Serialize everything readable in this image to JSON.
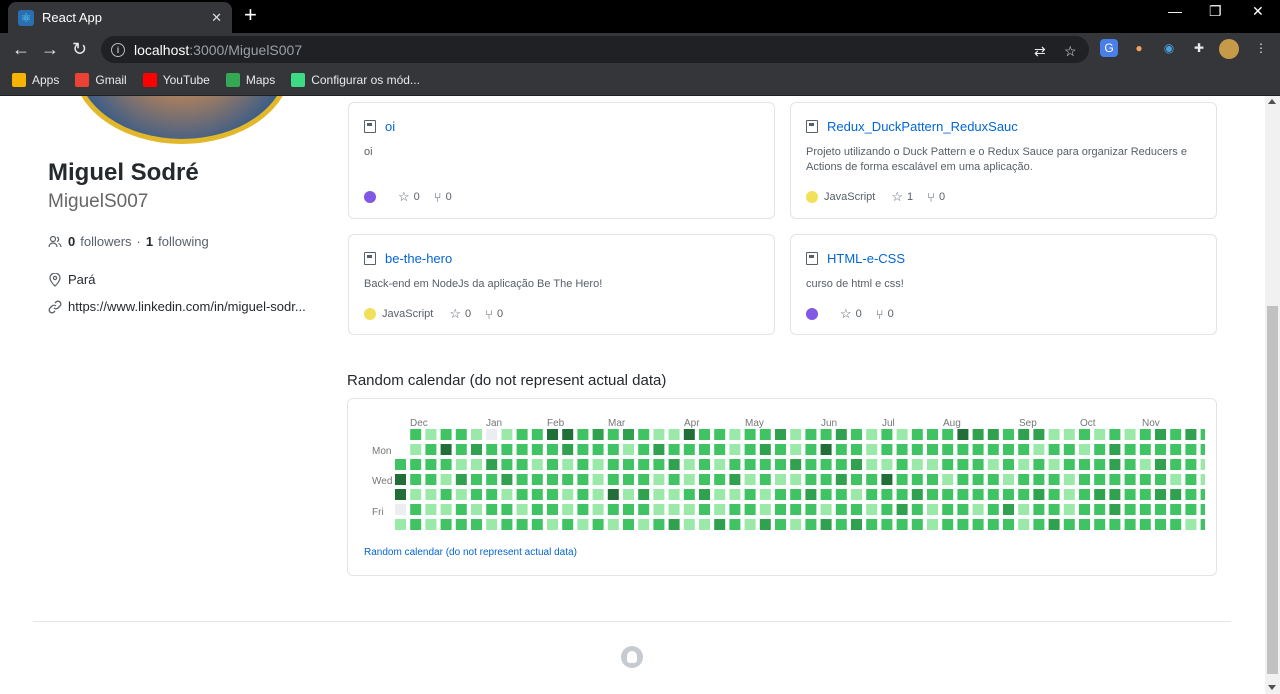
{
  "browser": {
    "tab_title": "React App",
    "tab_close": "✕",
    "new_tab": "+",
    "url_host": "localhost",
    "url_rest": ":3000/MiguelS007",
    "bookmarks": [
      {
        "label": "Apps",
        "icon": "apps-grid-icon",
        "color": "#f4b400"
      },
      {
        "label": "Gmail",
        "icon": "gmail-icon",
        "color": "#ea4335"
      },
      {
        "label": "YouTube",
        "icon": "youtube-icon",
        "color": "#ff0000"
      },
      {
        "label": "Maps",
        "icon": "maps-icon",
        "color": "#34a853"
      },
      {
        "label": "Configurar os mód...",
        "icon": "router-config-icon",
        "color": "#3ddc84"
      }
    ]
  },
  "profile": {
    "name": "Miguel Sodré",
    "login": "MiguelS007",
    "followers_count": "0",
    "followers_label": "followers",
    "separator": "·",
    "following_count": "1",
    "following_label": "following",
    "location": "Pará",
    "website": "https://www.linkedin.com/in/miguel-sodr..."
  },
  "repos": [
    {
      "name": "oi",
      "description": "oi",
      "language": "",
      "language_color": "#8257e5",
      "stars": "0",
      "forks": "0"
    },
    {
      "name": "Redux_DuckPattern_ReduxSauc",
      "description": "Projeto utilizando o Duck Pattern e o Redux Sauce para organizar Reducers e Actions de forma escalável em uma aplicação.",
      "language": "JavaScript",
      "language_color": "#f1e05a",
      "stars": "1",
      "forks": "0"
    },
    {
      "name": "be-the-hero",
      "description": "Back-end em NodeJs da aplicação Be The Hero!",
      "language": "JavaScript",
      "language_color": "#f1e05a",
      "stars": "0",
      "forks": "0"
    },
    {
      "name": "HTML-e-CSS",
      "description": "curso de html e css!",
      "language": "",
      "language_color": "#8257e5",
      "stars": "0",
      "forks": "0"
    }
  ],
  "calendar": {
    "title": "Random calendar (do not represent actual data)",
    "footer": "Random calendar (do not represent actual data)",
    "months": [
      "Dec",
      "Jan",
      "Feb",
      "Mar",
      "Apr",
      "May",
      "Jun",
      "Jul",
      "Aug",
      "Sep",
      "Oct",
      "Nov"
    ],
    "day_labels": [
      "Mon",
      "Wed",
      "Fri"
    ],
    "level_colors": [
      "#ebedf0",
      "#9be9a8",
      "#40c463",
      "#30a14e",
      "#216e39"
    ],
    "weeks": [
      [
        0,
        2,
        2,
        4,
        4,
        0,
        1
      ],
      [
        2,
        1,
        2,
        2,
        1,
        2,
        2
      ],
      [
        1,
        2,
        2,
        2,
        1,
        1,
        1
      ],
      [
        2,
        4,
        2,
        1,
        2,
        1,
        2
      ],
      [
        2,
        2,
        1,
        3,
        1,
        2,
        2
      ],
      [
        1,
        3,
        1,
        2,
        2,
        1,
        2
      ],
      [
        0,
        2,
        3,
        2,
        2,
        2,
        1
      ],
      [
        1,
        2,
        2,
        3,
        1,
        2,
        2
      ],
      [
        2,
        2,
        2,
        2,
        2,
        1,
        2
      ],
      [
        2,
        2,
        1,
        2,
        2,
        2,
        2
      ],
      [
        4,
        2,
        2,
        2,
        2,
        2,
        1
      ],
      [
        4,
        3,
        1,
        2,
        1,
        1,
        2
      ],
      [
        2,
        2,
        2,
        2,
        2,
        2,
        1
      ],
      [
        3,
        2,
        1,
        1,
        1,
        1,
        2
      ],
      [
        2,
        2,
        2,
        2,
        4,
        2,
        1
      ],
      [
        3,
        1,
        2,
        2,
        1,
        2,
        2
      ],
      [
        2,
        2,
        2,
        2,
        3,
        2,
        1
      ],
      [
        1,
        3,
        2,
        1,
        1,
        1,
        2
      ],
      [
        1,
        2,
        3,
        2,
        1,
        1,
        3
      ],
      [
        4,
        2,
        1,
        1,
        2,
        1,
        1
      ],
      [
        2,
        2,
        2,
        2,
        3,
        2,
        1
      ],
      [
        2,
        2,
        1,
        2,
        1,
        1,
        3
      ],
      [
        1,
        1,
        2,
        3,
        1,
        2,
        2
      ],
      [
        2,
        2,
        2,
        1,
        2,
        2,
        1
      ],
      [
        2,
        3,
        2,
        2,
        1,
        1,
        3
      ],
      [
        3,
        2,
        2,
        1,
        2,
        2,
        2
      ],
      [
        1,
        1,
        3,
        1,
        2,
        2,
        1
      ],
      [
        2,
        2,
        2,
        2,
        3,
        2,
        2
      ],
      [
        2,
        4,
        2,
        2,
        2,
        1,
        3
      ],
      [
        3,
        2,
        2,
        3,
        2,
        2,
        2
      ],
      [
        2,
        2,
        3,
        2,
        1,
        2,
        3
      ],
      [
        1,
        1,
        1,
        2,
        2,
        1,
        2
      ],
      [
        2,
        2,
        1,
        4,
        2,
        2,
        2
      ],
      [
        1,
        2,
        2,
        2,
        2,
        3,
        2
      ],
      [
        2,
        2,
        1,
        2,
        3,
        2,
        2
      ],
      [
        2,
        2,
        1,
        2,
        2,
        1,
        1
      ],
      [
        2,
        2,
        2,
        1,
        2,
        2,
        2
      ],
      [
        4,
        2,
        2,
        2,
        2,
        2,
        2
      ],
      [
        3,
        2,
        2,
        2,
        2,
        1,
        2
      ],
      [
        3,
        2,
        1,
        2,
        2,
        2,
        2
      ],
      [
        2,
        2,
        2,
        1,
        2,
        3,
        2
      ],
      [
        3,
        2,
        1,
        2,
        2,
        1,
        1
      ],
      [
        3,
        1,
        2,
        2,
        3,
        2,
        2
      ],
      [
        1,
        2,
        1,
        2,
        2,
        2,
        3
      ],
      [
        1,
        2,
        2,
        1,
        1,
        1,
        2
      ],
      [
        2,
        1,
        2,
        2,
        2,
        2,
        2
      ],
      [
        1,
        2,
        2,
        2,
        3,
        2,
        2
      ],
      [
        2,
        3,
        3,
        2,
        3,
        3,
        2
      ],
      [
        1,
        2,
        2,
        2,
        2,
        2,
        2
      ],
      [
        2,
        2,
        1,
        2,
        2,
        2,
        2
      ],
      [
        3,
        2,
        3,
        2,
        3,
        2,
        2
      ],
      [
        2,
        2,
        2,
        1,
        3,
        2,
        2
      ],
      [
        3,
        2,
        2,
        2,
        2,
        2,
        1
      ],
      [
        2,
        2,
        1,
        1,
        2,
        2,
        2
      ],
      [
        1,
        2,
        1,
        1,
        1,
        1,
        1
      ]
    ]
  }
}
